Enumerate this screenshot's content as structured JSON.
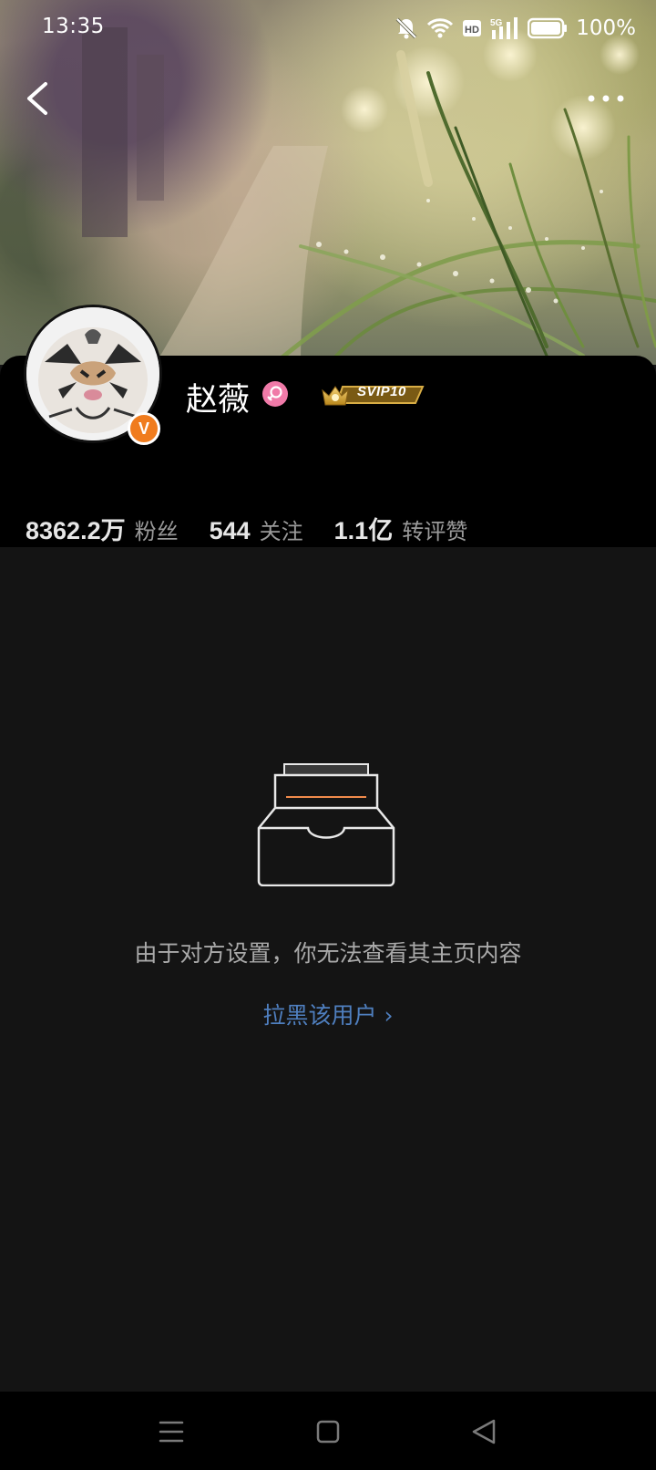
{
  "status_bar": {
    "time": "13:35",
    "battery": "100%",
    "icons": [
      "mute-bell-icon",
      "wifi-icon",
      "hd-icon",
      "5g-signal-icon",
      "battery-icon"
    ]
  },
  "header": {
    "back_icon": "chevron-left-icon",
    "more_icon": "more-dots-icon"
  },
  "profile": {
    "name": "赵薇",
    "gender_icon": "female-icon",
    "vip_label": "SVIP10",
    "verified_icon": "verified-v-icon",
    "verified_letter": "V",
    "stats": [
      {
        "value": "8362.2万",
        "label": "粉丝"
      },
      {
        "value": "544",
        "label": "关注"
      },
      {
        "value": "1.1亿",
        "label": "转评赞"
      }
    ]
  },
  "empty_state": {
    "illustration": "empty-box-icon",
    "message": "由于对方设置，你无法查看其主页内容",
    "block_link": "拉黑该用户",
    "block_link_chevron": "›"
  },
  "system_nav": [
    "menu-icon",
    "home-square-icon",
    "back-triangle-icon"
  ],
  "colors": {
    "background": "#141414",
    "panel": "#000000",
    "link": "#4f7fbf",
    "verified_orange": "#f07c1e",
    "gender_pink": "#f07aa8",
    "vip_gold": "#d4a62a"
  }
}
